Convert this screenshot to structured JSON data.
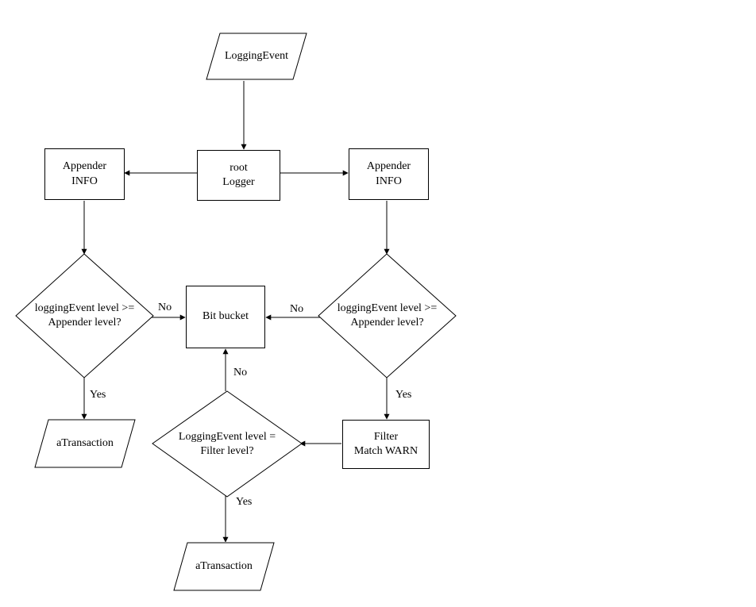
{
  "nodes": {
    "loggingEvent": "LoggingEvent",
    "rootLogger": "root\nLogger",
    "appenderLeft": "Appender\nINFO",
    "appenderRight": "Appender\nINFO",
    "decisionLeft": "loggingEvent level >=\nAppender level?",
    "decisionRight": "loggingEvent level >=\nAppender level?",
    "bitBucket": "Bit bucket",
    "filterMatchWarn": "Filter\nMatch WARN",
    "decisionFilter": "LoggingEvent level =\nFilter level?",
    "aTransactionLeft": "aTransaction",
    "aTransactionBottom": "aTransaction"
  },
  "edgeLabels": {
    "no": "No",
    "yes": "Yes"
  }
}
